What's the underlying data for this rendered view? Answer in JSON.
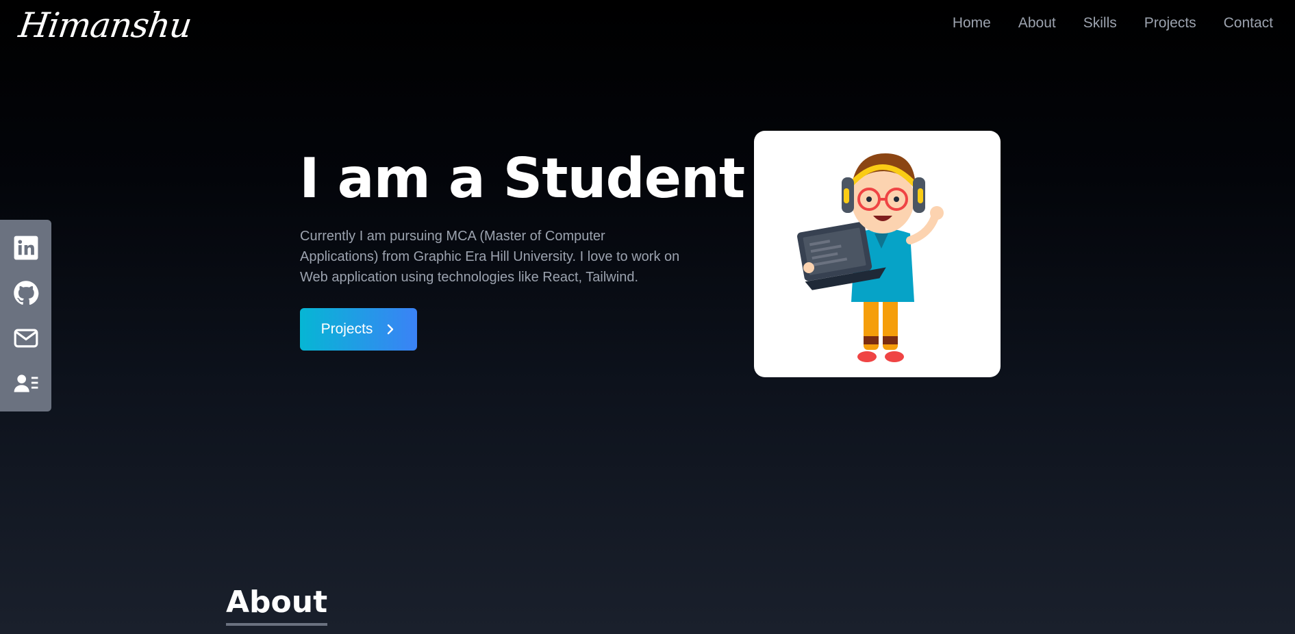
{
  "brand": {
    "logo_text": "Himanshu"
  },
  "nav": {
    "items": [
      {
        "label": "Home"
      },
      {
        "label": "About"
      },
      {
        "label": "Skills"
      },
      {
        "label": "Projects"
      },
      {
        "label": "Contact"
      }
    ]
  },
  "social": {
    "links": [
      {
        "icon": "linkedin-icon"
      },
      {
        "icon": "github-icon"
      },
      {
        "icon": "mail-icon"
      },
      {
        "icon": "resume-icon"
      }
    ],
    "bar_color": "#6b7280"
  },
  "hero": {
    "title": "I am a Student",
    "description": "Currently I am pursuing MCA (Master of Computer Applications) from Graphic Era Hill University. I love to work on Web application using technologies like React, Tailwind.",
    "cta_label": "Projects",
    "cta_icon": "chevron-right-icon",
    "cta_gradient": [
      "#06b6d4",
      "#3b82f6"
    ]
  },
  "about": {
    "heading": "About"
  }
}
